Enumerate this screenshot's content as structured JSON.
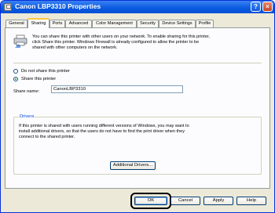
{
  "window": {
    "title": "Canon LBP3310 Properties"
  },
  "tabs": [
    {
      "label": "General"
    },
    {
      "label": "Sharing",
      "active": true
    },
    {
      "label": "Ports"
    },
    {
      "label": "Advanced"
    },
    {
      "label": "Color Management"
    },
    {
      "label": "Security"
    },
    {
      "label": "Device Settings"
    },
    {
      "label": "Profile"
    }
  ],
  "sharing": {
    "info_text": "You can share this printer with other users on your network. To enable sharing for this printer, click Share this printer. Windows Firewall is already configured to allow the printer to be shared with other computers on the network.",
    "option_no_share": "Do not share this printer",
    "option_share": "Share this printer",
    "selected_option": "share",
    "share_name_label": "Share name:",
    "share_name_value": "CanonLBP3310"
  },
  "drivers": {
    "title": "Drivers",
    "text": "If this printer is shared with users running different versions of Windows, you may want to install additional drivers, so that the users do not have to find the print driver when they connect to the shared printer.",
    "additional_drivers_button": "Additional Drivers..."
  },
  "footer": {
    "ok": "OK",
    "cancel": "Cancel",
    "apply": "Apply",
    "help": "Help"
  },
  "icons": {
    "title": "printer-icon",
    "help": "help-icon",
    "close": "close-icon",
    "sharing": "shared-printer-icon"
  },
  "colors": {
    "titlebar": "#0a5ae0",
    "active_tab_accent": "#ffc83c",
    "group_title": "#0046d5"
  }
}
